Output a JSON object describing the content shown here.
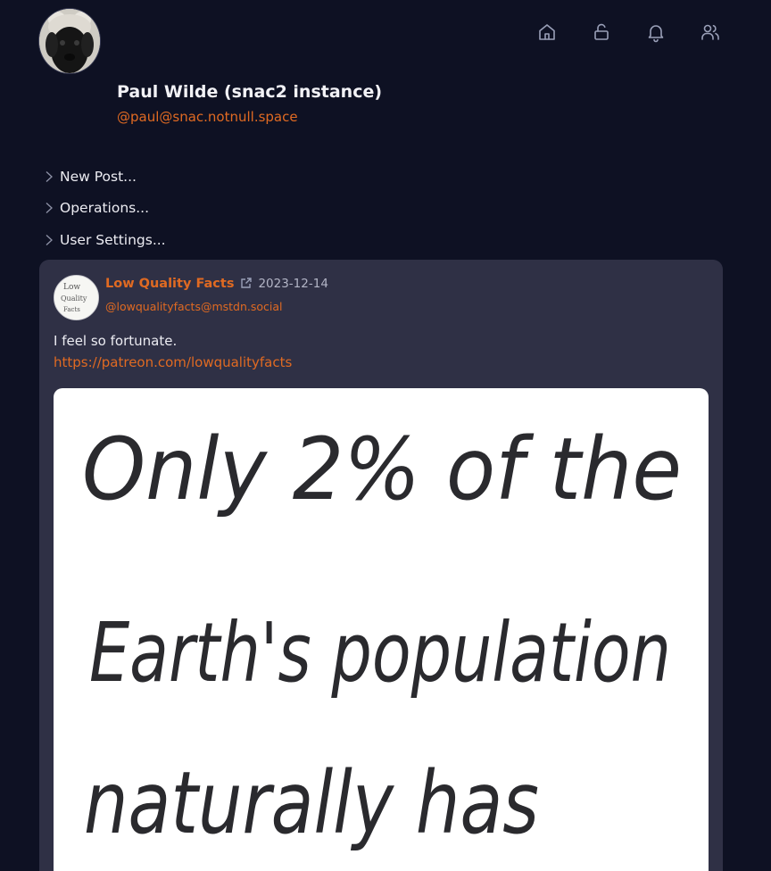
{
  "profile": {
    "name": "Paul Wilde (snac2 instance)",
    "handle": "@paul@snac.notnull.space",
    "avatar_icon": "dog-avatar"
  },
  "nav": [
    {
      "icon": "home-icon",
      "label": "Home"
    },
    {
      "icon": "unlock-icon",
      "label": "Public"
    },
    {
      "icon": "bell-icon",
      "label": "Notifications"
    },
    {
      "icon": "people-icon",
      "label": "People"
    }
  ],
  "menu": {
    "new_post": "New Post...",
    "operations": "Operations...",
    "user_settings": "User Settings..."
  },
  "post": {
    "author_name": "Low Quality Facts",
    "author_handle": "@lowqualityfacts@mstdn.social",
    "date": "2023-12-14",
    "text": "I feel so fortunate.",
    "link": "https://patreon.com/lowqualityfacts",
    "avatar_text": [
      "Low",
      "Quality",
      "Facts"
    ],
    "image_lines": [
      "Only 2% of the",
      "Earth's population",
      "naturally has"
    ]
  },
  "colors": {
    "background": "#0e1123",
    "card": "#2f3045",
    "accent": "#e06a22"
  }
}
